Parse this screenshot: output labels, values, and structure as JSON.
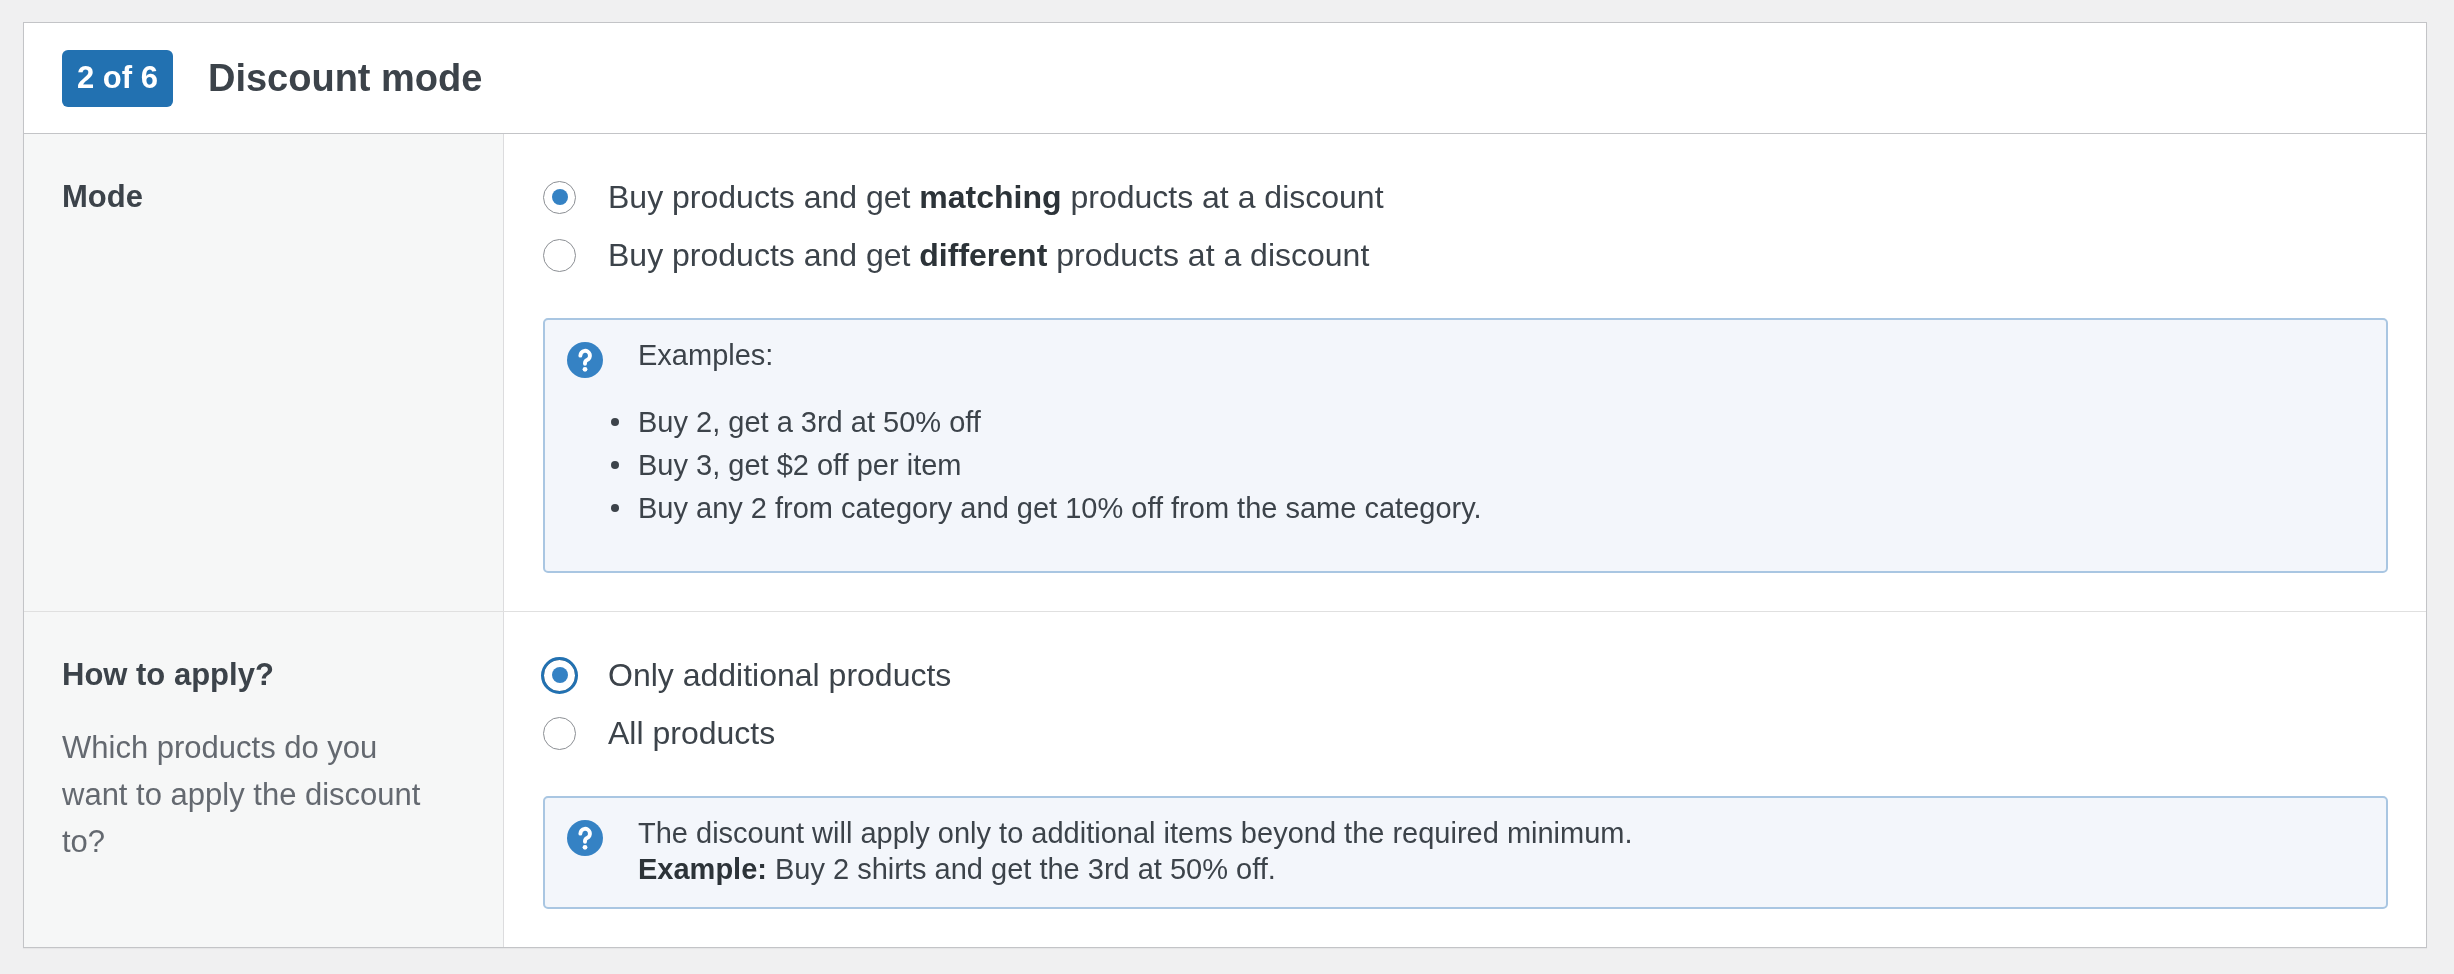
{
  "section": {
    "step_badge": "2 of 6",
    "title": "Discount mode"
  },
  "rows": [
    {
      "label": "Mode",
      "options": [
        {
          "label": "Buy products and get **matching** products at a discount",
          "selected": true,
          "focused": false
        },
        {
          "label": "Buy products and get **different** products at a discount",
          "selected": false,
          "focused": false
        }
      ],
      "help": {
        "paragraphs": [
          "Examples:"
        ],
        "items": [
          "Buy 2, get a 3rd at 50% off",
          "Buy 3, get $2 off per item",
          "Buy any 2 from category and get 10% off from the same category."
        ]
      }
    },
    {
      "label": "How to apply?",
      "description": "Which products do you want to apply the discount to?",
      "options": [
        {
          "label": "Only additional products",
          "selected": true,
          "focused": true
        },
        {
          "label": "All products",
          "selected": false,
          "focused": false
        }
      ],
      "help": {
        "paragraphs": [
          "The discount will apply only to additional items beyond the required minimum.",
          "**Example:** Buy 2 shirts and get the 3rd at 50% off."
        ]
      }
    }
  ]
}
